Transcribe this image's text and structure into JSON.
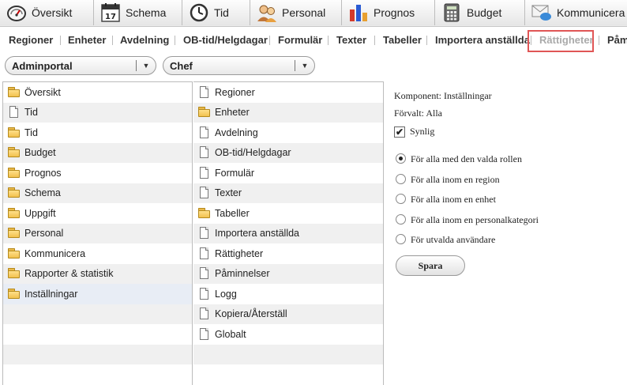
{
  "top_tabs": [
    {
      "label": "Översikt",
      "icon": "gauge-icon"
    },
    {
      "label": "Schema",
      "icon": "calendar-icon",
      "badge": "17"
    },
    {
      "label": "Tid",
      "icon": "clock-icon"
    },
    {
      "label": "Personal",
      "icon": "people-icon"
    },
    {
      "label": "Prognos",
      "icon": "bar-chart-icon"
    },
    {
      "label": "Budget",
      "icon": "calculator-icon"
    },
    {
      "label": "Kommunicera",
      "icon": "envelope-icon"
    }
  ],
  "submenu": [
    "Regioner",
    "Enheter",
    "Avdelning",
    "OB-tid/Helgdagar",
    "Formulär",
    "Texter",
    "Tabeller",
    "Importera anställda",
    "Rättigheter",
    "Påm"
  ],
  "submenu_active": "Rättigheter",
  "dropdowns": {
    "portal": "Adminportal",
    "role": "Chef"
  },
  "left_tree": [
    {
      "label": "Översikt",
      "icon": "folder-icon"
    },
    {
      "label": "Tid",
      "icon": "page-icon"
    },
    {
      "label": "Tid",
      "icon": "folder-icon"
    },
    {
      "label": "Budget",
      "icon": "folder-icon"
    },
    {
      "label": "Prognos",
      "icon": "folder-icon"
    },
    {
      "label": "Schema",
      "icon": "folder-icon"
    },
    {
      "label": "Uppgift",
      "icon": "folder-icon"
    },
    {
      "label": "Personal",
      "icon": "folder-icon"
    },
    {
      "label": "Kommunicera",
      "icon": "folder-icon"
    },
    {
      "label": "Rapporter & statistik",
      "icon": "folder-icon"
    },
    {
      "label": "Inställningar",
      "icon": "folder-open-icon"
    }
  ],
  "middle_list": [
    {
      "label": "Regioner",
      "icon": "page-icon"
    },
    {
      "label": "Enheter",
      "icon": "folder-icon"
    },
    {
      "label": "Avdelning",
      "icon": "page-icon"
    },
    {
      "label": "OB-tid/Helgdagar",
      "icon": "page-icon"
    },
    {
      "label": "Formulär",
      "icon": "page-icon"
    },
    {
      "label": "Texter",
      "icon": "page-icon"
    },
    {
      "label": "Tabeller",
      "icon": "folder-icon"
    },
    {
      "label": "Importera anställda",
      "icon": "page-icon"
    },
    {
      "label": "Rättigheter",
      "icon": "page-icon"
    },
    {
      "label": "Påminnelser",
      "icon": "page-icon"
    },
    {
      "label": "Logg",
      "icon": "page-icon"
    },
    {
      "label": "Kopiera/Återställ",
      "icon": "page-icon"
    },
    {
      "label": "Globalt",
      "icon": "page-icon"
    }
  ],
  "settings": {
    "component": "Komponent: Inställningar",
    "default": "Förvalt: Alla",
    "visible_label": "Synlig",
    "visible_checked": true,
    "options": [
      "För alla med den valda rollen",
      "För alla inom en region",
      "För alla inom en enhet",
      "För alla inom en personalkategori",
      "För utvalda användare"
    ],
    "selected_option": 0,
    "save_label": "Spara"
  },
  "colors": {
    "highlight_border": "#e05656",
    "folder": "#f2c14e",
    "active_submenu": "#aaaaaa"
  }
}
